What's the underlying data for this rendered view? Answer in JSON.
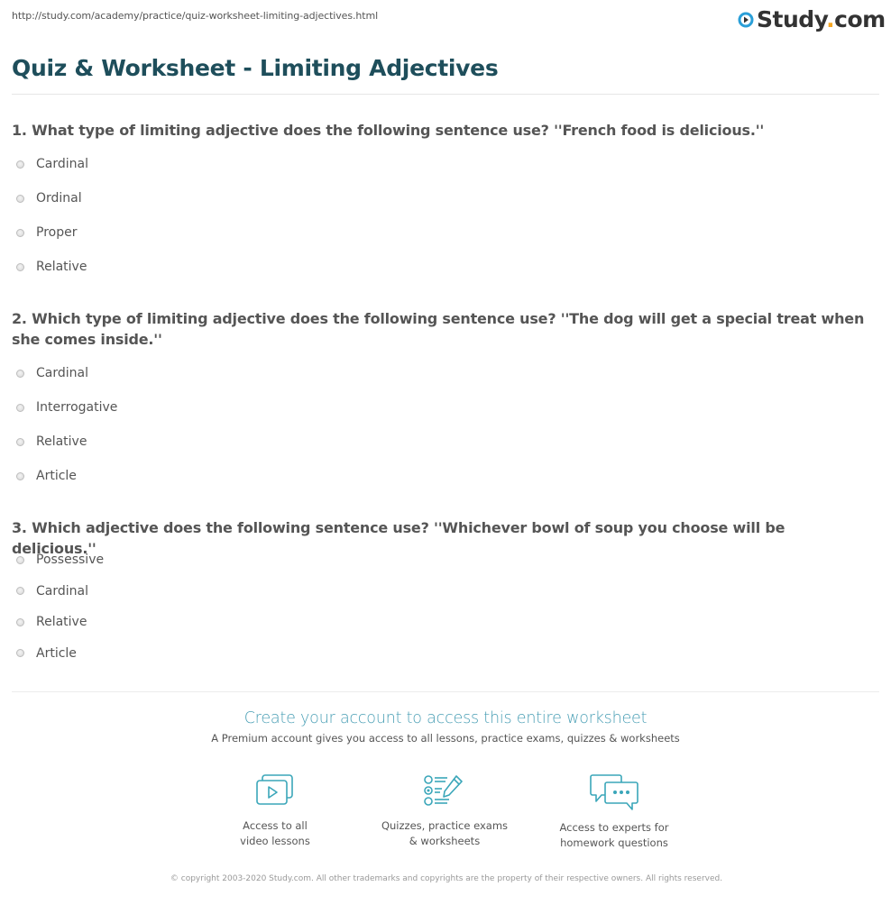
{
  "page": {
    "url": "http://study.com/academy/practice/quiz-worksheet-limiting-adjectives.html",
    "brand": {
      "name_main": "Study",
      "name_dot": ".",
      "name_tld": "com",
      "accent": "#f5a623",
      "icon_color": "#2a9fd8"
    },
    "title": "Quiz & Worksheet - Limiting Adjectives"
  },
  "questions": [
    {
      "text": "1. What type of limiting adjective does the following sentence use? ''French food is delicious.''",
      "options": [
        "Cardinal",
        "Ordinal",
        "Proper",
        "Relative"
      ]
    },
    {
      "text": "2. Which type of limiting adjective does the following sentence use? ''The dog will get a special treat when she comes inside.''",
      "options": [
        "Cardinal",
        "Interrogative",
        "Relative",
        "Article"
      ]
    },
    {
      "text": "3. Which adjective does the following sentence use? ''Whichever bowl of soup you choose will be delicious.''",
      "options": [
        "Possessive",
        "Cardinal",
        "Relative",
        "Article"
      ]
    }
  ],
  "cta": {
    "title": "Create your account to access this entire worksheet",
    "subtitle": "A Premium account gives you access to all lessons, practice exams, quizzes & worksheets",
    "features": [
      {
        "icon": "video-lessons-icon",
        "line1": "Access to all",
        "line2": "video lessons"
      },
      {
        "icon": "quiz-checklist-icon",
        "line1": "Quizzes, practice exams",
        "line2": "& worksheets"
      },
      {
        "icon": "chat-bubbles-icon",
        "line1": "Access to experts for",
        "line2": "homework questions"
      }
    ],
    "icon_color": "#3aa6b9"
  },
  "footer": {
    "copyright": "© copyright 2003-2020 Study.com. All other trademarks and copyrights are the property of their respective owners. All rights reserved."
  }
}
